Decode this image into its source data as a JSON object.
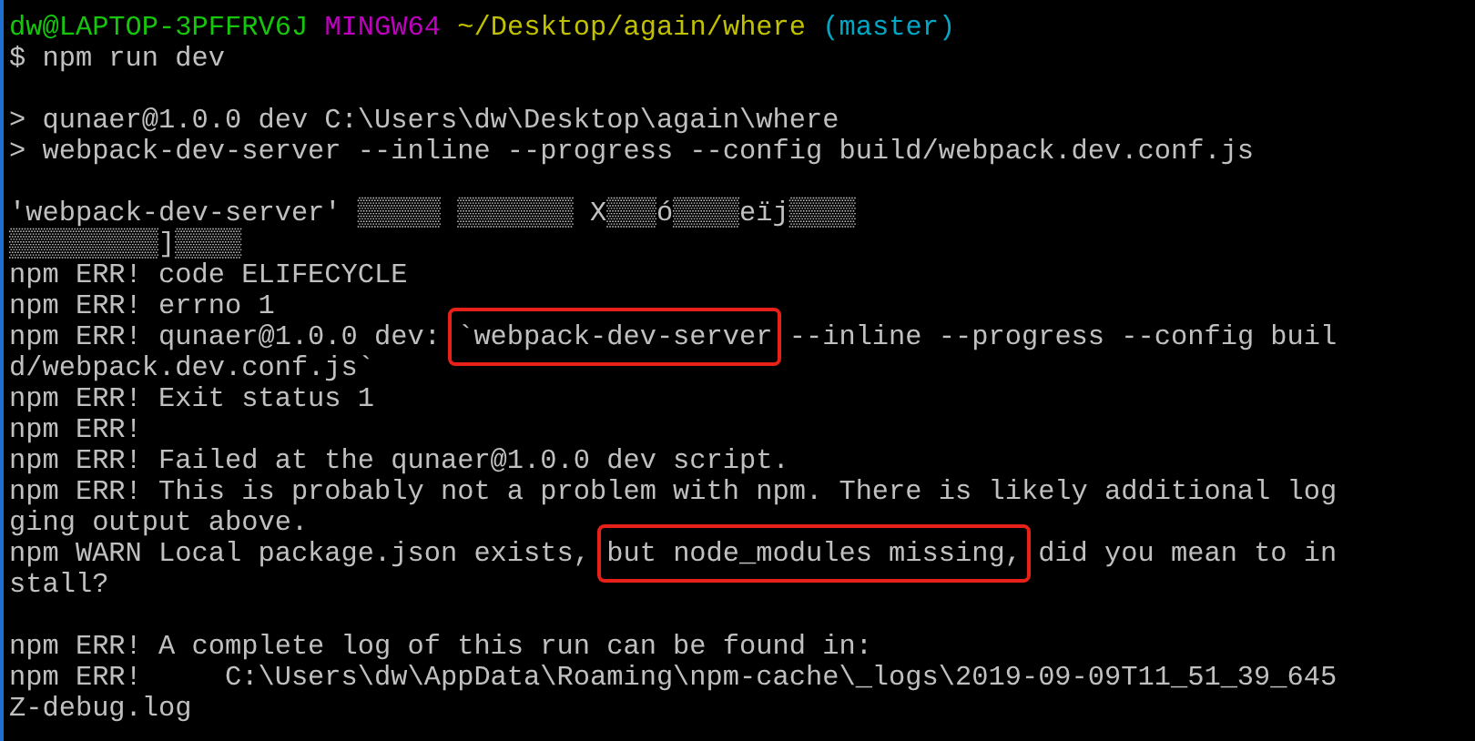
{
  "terminal": {
    "lines": [
      {
        "kind": "prompt",
        "segments": [
          {
            "text": "dw@LAPTOP-3PFFRV6J",
            "color": "#16c60c"
          },
          {
            "text": "MINGW64",
            "color": "#c000c0"
          },
          {
            "text": "~/Desktop/again/where",
            "color": "#c1c100"
          },
          {
            "text": "(master)",
            "color": "#00a8c6"
          }
        ]
      },
      {
        "kind": "text",
        "segments": [
          {
            "text": "$ npm run dev"
          }
        ]
      },
      {
        "kind": "blank"
      },
      {
        "kind": "text",
        "segments": [
          {
            "text": "> qunaer@1.0.0 dev C:\\Users\\dw\\Desktop\\again\\where"
          }
        ]
      },
      {
        "kind": "text",
        "segments": [
          {
            "text": "> webpack-dev-server --inline --progress --config build/webpack.dev.conf.js"
          }
        ]
      },
      {
        "kind": "blank"
      },
      {
        "kind": "text",
        "segments": [
          {
            "text": "'webpack-dev-server' ▒▒▒▒▒ ▒▒▒▒▒▒▒ X▒▒▒ó▒▒▒▒eïj▒▒▒▒"
          }
        ]
      },
      {
        "kind": "text",
        "segments": [
          {
            "text": "▒▒▒▒▒▒▒▒▒]▒▒▒▒"
          }
        ]
      },
      {
        "kind": "text",
        "segments": [
          {
            "text": "npm ERR! code ELIFECYCLE"
          }
        ]
      },
      {
        "kind": "text",
        "segments": [
          {
            "text": "npm ERR! errno 1"
          }
        ]
      },
      {
        "kind": "text",
        "segments": [
          {
            "text": "npm ERR! qunaer@1.0.0 dev: ",
            "boxed": false
          },
          {
            "text": "`webpack-dev-server",
            "boxed": true
          },
          {
            "text": " --inline --progress --config buil",
            "boxed": false
          }
        ]
      },
      {
        "kind": "text",
        "segments": [
          {
            "text": "d/webpack.dev.conf.js`"
          }
        ]
      },
      {
        "kind": "text",
        "segments": [
          {
            "text": "npm ERR! Exit status 1"
          }
        ]
      },
      {
        "kind": "text",
        "segments": [
          {
            "text": "npm ERR!"
          }
        ]
      },
      {
        "kind": "text",
        "segments": [
          {
            "text": "npm ERR! Failed at the qunaer@1.0.0 dev script."
          }
        ]
      },
      {
        "kind": "text",
        "segments": [
          {
            "text": "npm ERR! This is probably not a problem with npm. There is likely additional log"
          }
        ]
      },
      {
        "kind": "text",
        "segments": [
          {
            "text": "ging output above."
          }
        ]
      },
      {
        "kind": "text",
        "segments": [
          {
            "text": "npm WARN Local package.json exists, ",
            "boxed": false
          },
          {
            "text": "but node_modules missing,",
            "boxed": true
          },
          {
            "text": " did you mean to in",
            "boxed": false
          }
        ]
      },
      {
        "kind": "text",
        "segments": [
          {
            "text": "stall?"
          }
        ]
      },
      {
        "kind": "blank"
      },
      {
        "kind": "text",
        "segments": [
          {
            "text": "npm ERR! A complete log of this run can be found in:"
          }
        ]
      },
      {
        "kind": "text",
        "segments": [
          {
            "text": "npm ERR!     C:\\Users\\dw\\AppData\\Roaming\\npm-cache\\_logs\\2019-09-09T11_51_39_645"
          }
        ]
      },
      {
        "kind": "text",
        "segments": [
          {
            "text": "Z-debug.log"
          }
        ]
      }
    ]
  }
}
